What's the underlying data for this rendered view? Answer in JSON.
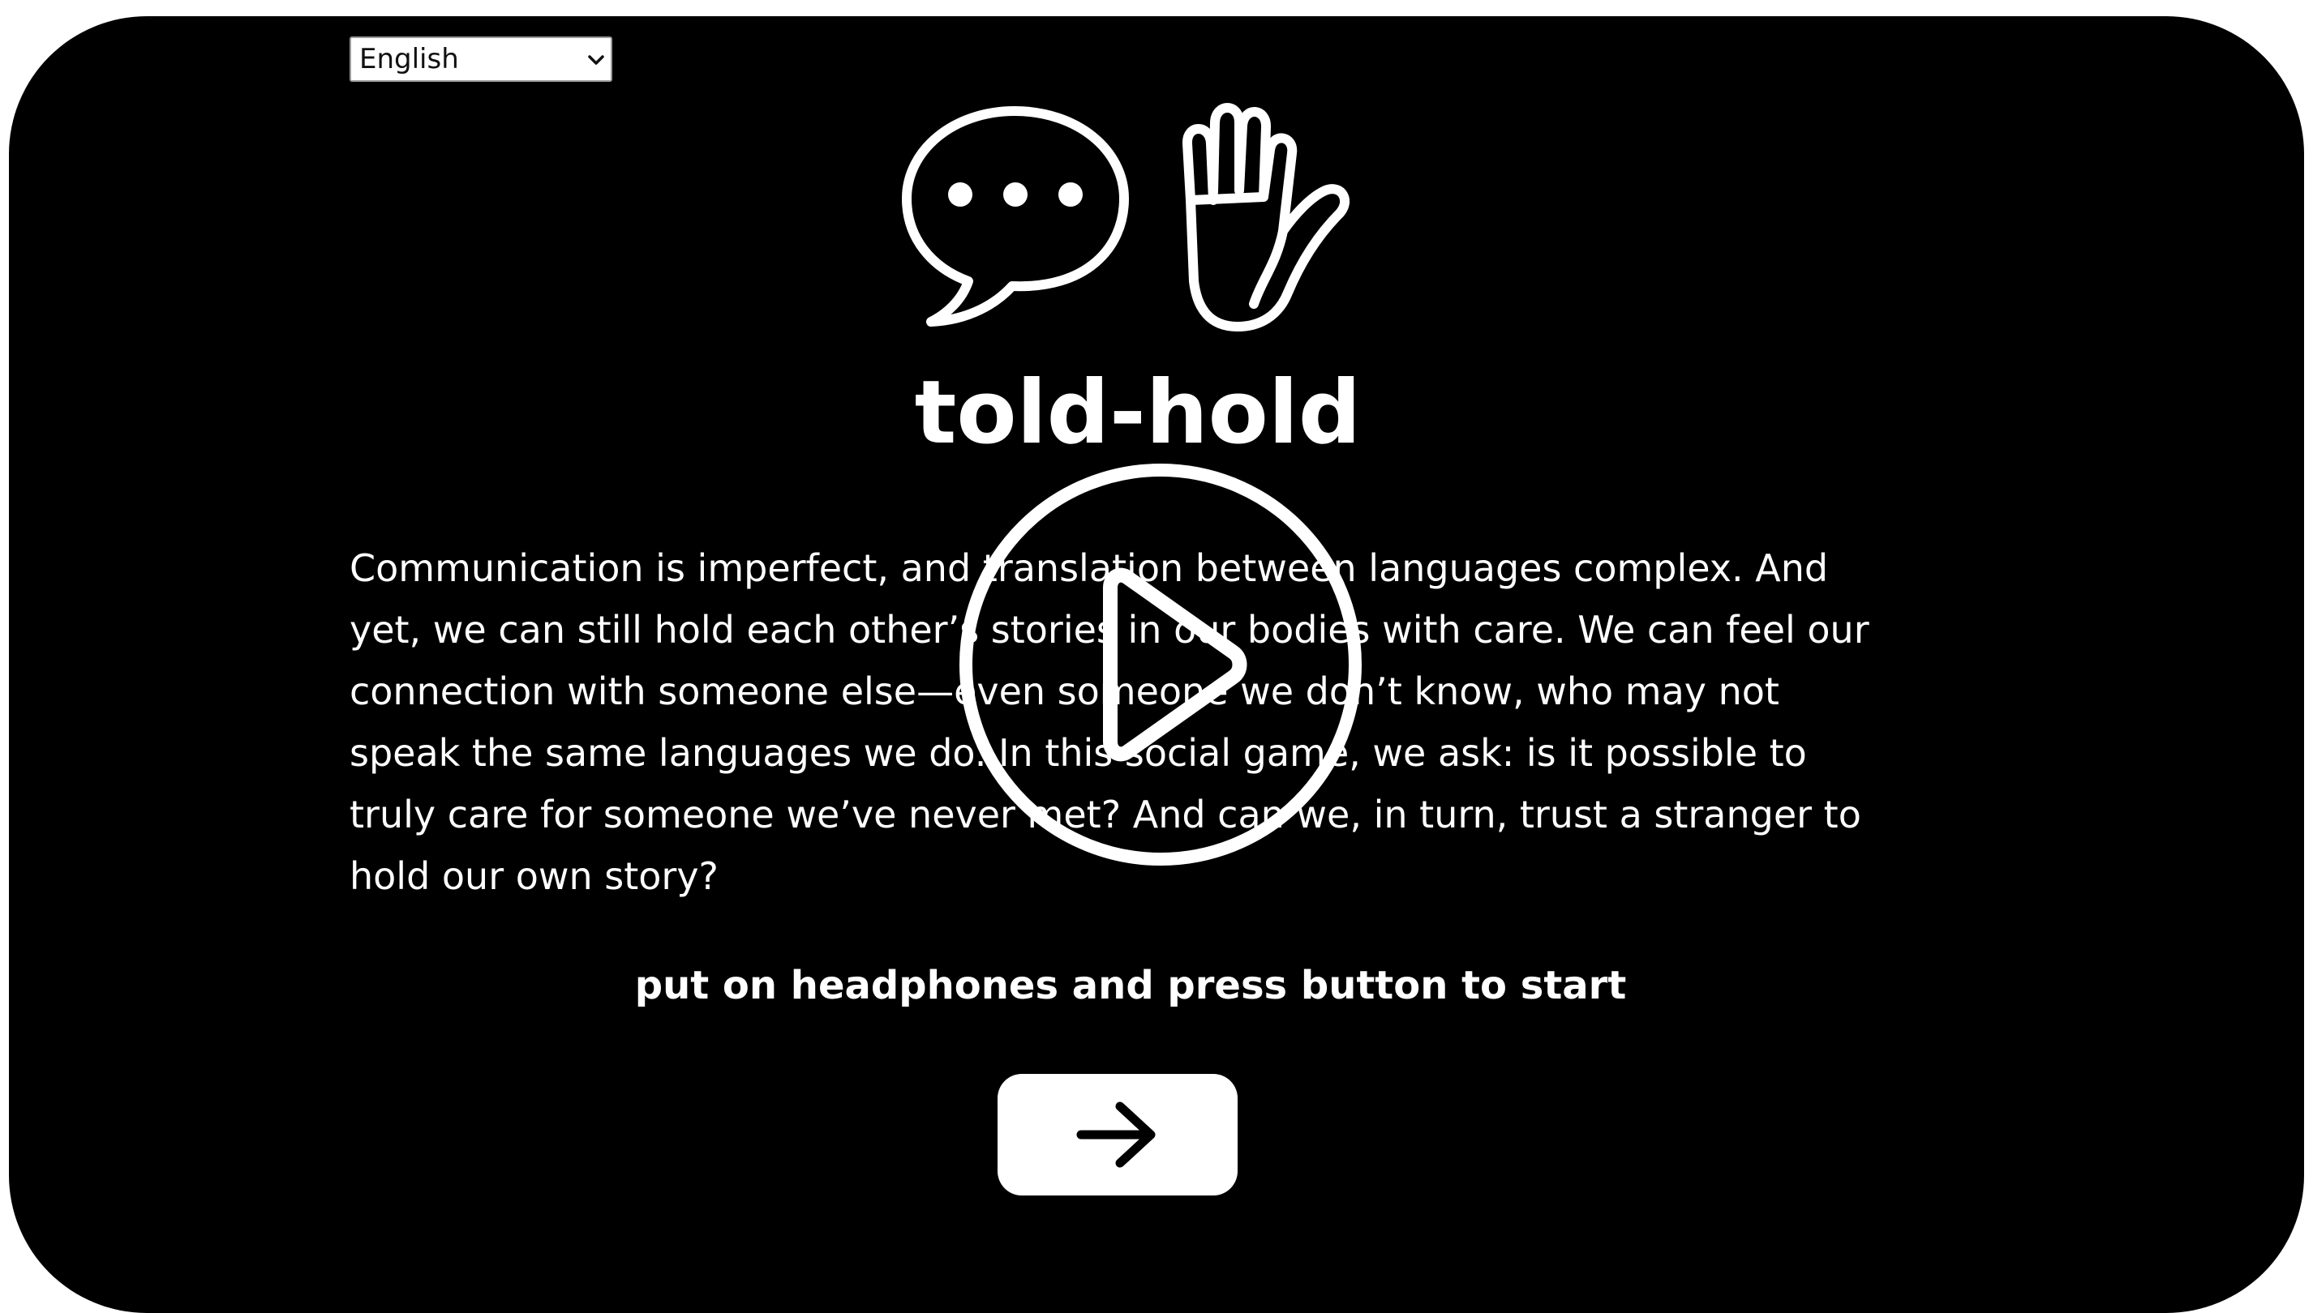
{
  "language_select": {
    "selected": "English",
    "options": [
      "English"
    ]
  },
  "hero": {
    "icons": [
      "speech-bubble-icon",
      "raised-hand-icon"
    ]
  },
  "title": "told-hold",
  "description": "Communication is imperfect, and translation between languages complex. And yet, we can still hold each other’s stories in our bodies with care. We can feel our connection with someone else—even someone we don’t know, who may not speak the same languages we do. In this social game, we ask: is it possible to truly care for someone we’ve never met? And can we, in turn, trust a stranger to hold our own story?",
  "instruction": "put on headphones and press button to start",
  "start_button": {
    "icon": "arrow-right-icon"
  },
  "video_overlay": {
    "icon": "play-icon"
  },
  "colors": {
    "background": "#000000",
    "text": "#ffffff",
    "button_bg": "#ffffff",
    "button_icon": "#000000"
  }
}
